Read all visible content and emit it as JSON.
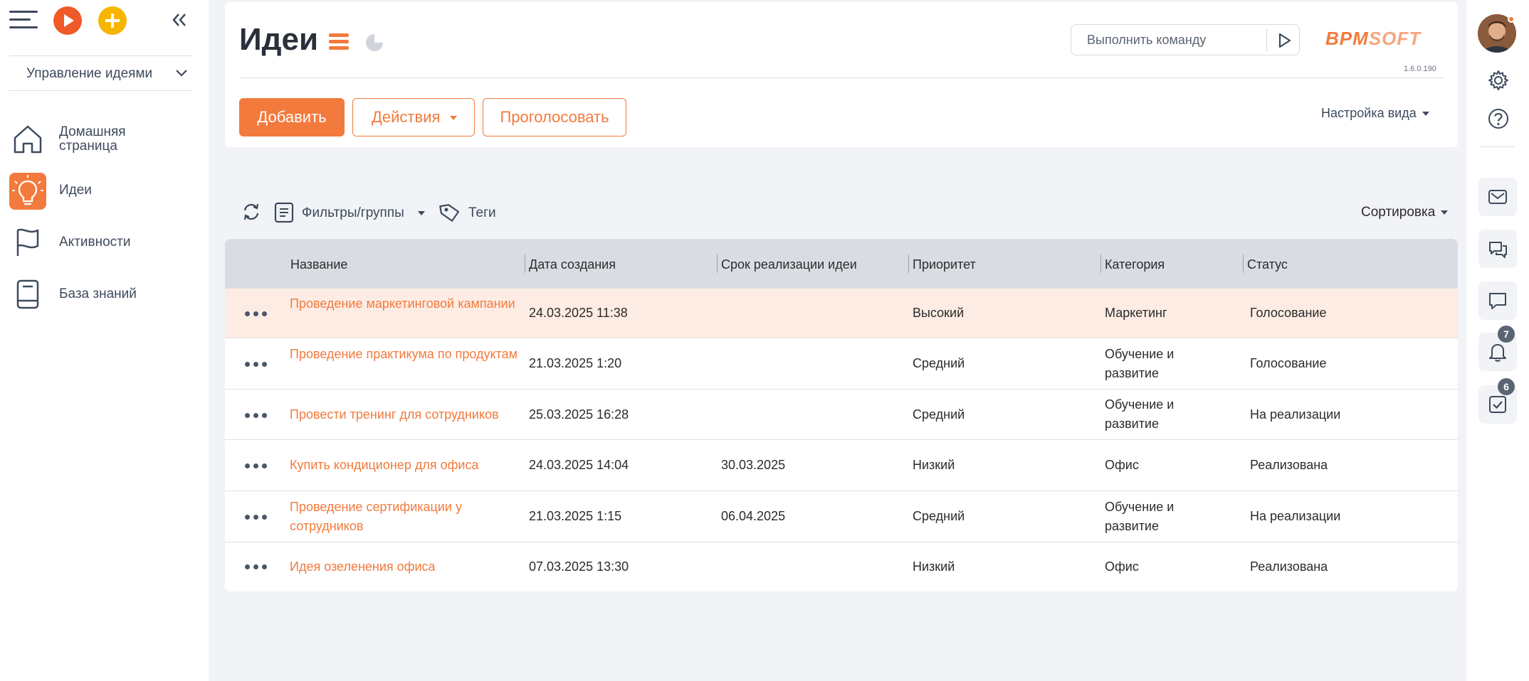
{
  "sidebar": {
    "section_label": "Управление идеями",
    "nav": [
      {
        "label_line1": "Домашняя",
        "label_line2": "страница",
        "icon": "home-icon"
      },
      {
        "label": "Идеи",
        "icon": "lightbulb-icon"
      },
      {
        "label": "Активности",
        "icon": "flag-icon"
      },
      {
        "label": "База знаний",
        "icon": "book-icon"
      }
    ]
  },
  "header": {
    "title": "Идеи",
    "command_placeholder": "Выполнить команду",
    "logo_main": "BPM",
    "logo_soft": "SOFT",
    "version": "1.6.0.190",
    "add_label": "Добавить",
    "actions_label": "Действия",
    "vote_label": "Проголосовать",
    "view_settings_label": "Настройка вида"
  },
  "toolbar": {
    "filters_label": "Фильтры/группы",
    "tags_label": "Теги",
    "sort_label": "Сортировка"
  },
  "grid": {
    "columns": [
      "Название",
      "Дата создания",
      "Срок реализации идеи",
      "Приоритет",
      "Категория",
      "Статус"
    ],
    "rows": [
      {
        "name": "Проведение маркетинговой кампании",
        "date": "24.03.2025 11:38",
        "deadline": "",
        "priority": "Высокий",
        "category": "Маркетинг",
        "status": "Голосование"
      },
      {
        "name": "Проведение практикума по продуктам",
        "date": "21.03.2025 1:20",
        "deadline": "",
        "priority": "Средний",
        "category": "Обучение и развитие",
        "status": "Голосование"
      },
      {
        "name": "Провести тренинг для сотрудников",
        "date": "25.03.2025 16:28",
        "deadline": "",
        "priority": "Средний",
        "category": "Обучение и развитие",
        "status": "На реализации"
      },
      {
        "name": "Купить кондиционер для офиса",
        "date": "24.03.2025 14:04",
        "deadline": "30.03.2025",
        "priority": "Низкий",
        "category": "Офис",
        "status": "Реализована"
      },
      {
        "name": "Проведение сертификации у сотрудников",
        "date": "21.03.2025 1:15",
        "deadline": "06.04.2025",
        "priority": "Средний",
        "category": "Обучение и развитие",
        "status": "На реализации"
      },
      {
        "name": "Идея озеленения офиса",
        "date": "07.03.2025 13:30",
        "deadline": "",
        "priority": "Низкий",
        "category": "Офис",
        "status": "Реализована"
      }
    ]
  },
  "rightbar": {
    "notifications_count": "7",
    "tasks_count": "6"
  },
  "colors": {
    "accent": "#f37a3d",
    "highlight_row": "#fdece4",
    "grid_header": "#d9dde3"
  }
}
